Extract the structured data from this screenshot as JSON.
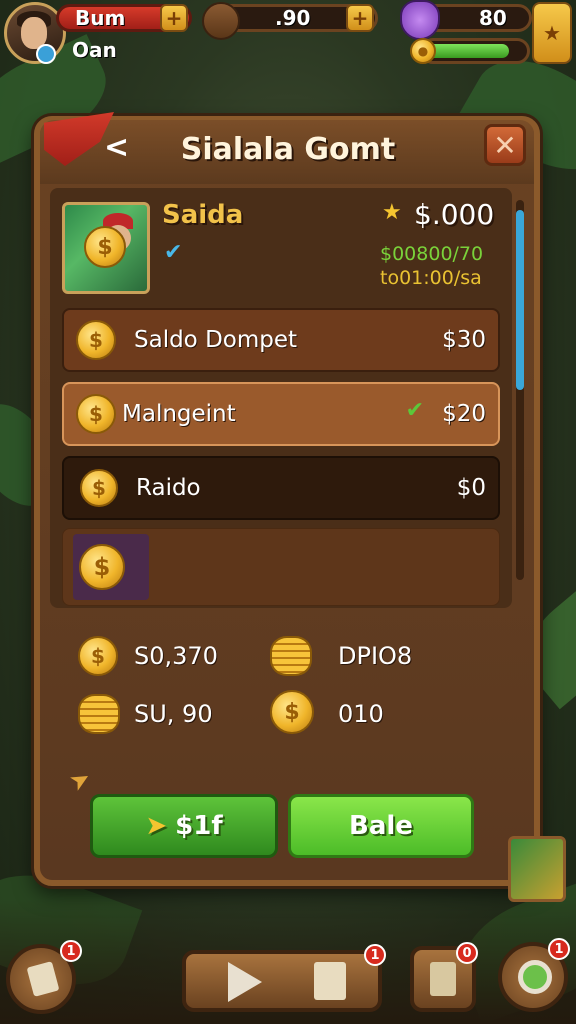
{
  "hud": {
    "player_name": "Bum",
    "player_sub": "Oan",
    "coins_value": ".90",
    "gems_value": "80",
    "energy_fraction": 0.85
  },
  "dialog": {
    "title": "Sialala Gomt",
    "profile": {
      "name": "Saida",
      "balance": "$.000",
      "line1": "$00800/70",
      "line2": "to01:00/sa"
    },
    "rows": [
      {
        "label": "Saldo Dompet",
        "value": "$30"
      },
      {
        "label": "Malngeint",
        "value": "$20"
      },
      {
        "label": "Raido",
        "value": "$0"
      }
    ],
    "stats": [
      {
        "value": "S0,370"
      },
      {
        "value": "DPIO8"
      },
      {
        "value": "SU, 90"
      },
      {
        "value": "010"
      }
    ],
    "buttons": {
      "left_label": "$1f",
      "right_label": "Bale"
    }
  },
  "bottom_nav": {
    "badges": [
      "1",
      "1",
      "0",
      "1"
    ]
  },
  "colors": {
    "panel": "#6a4222",
    "accent_green": "#5cc83a",
    "gold": "#f0b52a",
    "badge_red": "#d72a1e"
  }
}
